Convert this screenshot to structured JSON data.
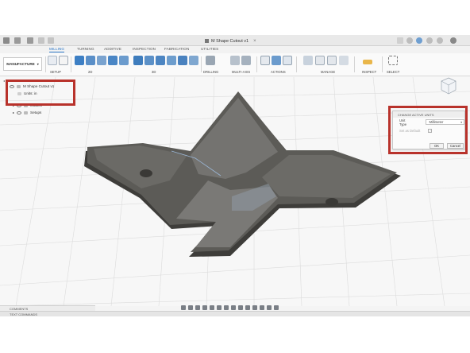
{
  "window": {
    "document_title": "M Shape Cutout v1"
  },
  "tabs": [
    {
      "label": "MILLING",
      "active": true
    },
    {
      "label": "TURNING",
      "active": false
    },
    {
      "label": "ADDITIVE",
      "active": false
    },
    {
      "label": "INSPECTION",
      "active": false
    },
    {
      "label": "FABRICATION",
      "active": false
    },
    {
      "label": "UTILITIES",
      "active": false
    }
  ],
  "toolbar": {
    "workspace": "MANUFACTURE",
    "groups": [
      "SETUP",
      "2D",
      "3D",
      "DRILLING",
      "MULTI-AXIS",
      "ACTIONS",
      "MANAGE",
      "INSPECT",
      "SELECT"
    ]
  },
  "browser": {
    "header": "BROWSER",
    "root": "M Shape Cutout v1",
    "units": "Units: in",
    "items": [
      "Models",
      "Setups"
    ]
  },
  "dialog": {
    "title": "CHANGE ACTIVE UNITS",
    "unit_type_label": "Unit Type",
    "unit_type_value": "Millimeter",
    "set_default_label": "Set as Default",
    "ok_label": "OK",
    "cancel_label": "Cancel"
  },
  "bottom": {
    "comments_label": "COMMENTS",
    "text_commands_label": "TEXT COMMANDS"
  },
  "colors": {
    "accent": "#2a76c6",
    "highlight_box": "#b8322b",
    "model_fill": "#5c5b57",
    "model_dark": "#3e3d3a"
  }
}
